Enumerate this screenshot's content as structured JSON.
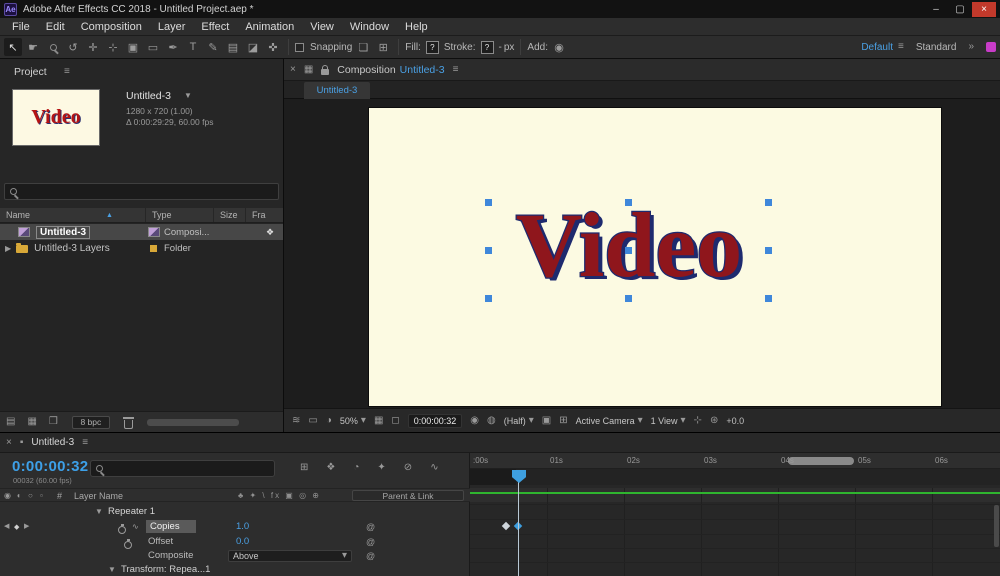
{
  "titlebar": {
    "app_icon": "Ae",
    "title": "Adobe After Effects CC 2018 - Untitled Project.aep *"
  },
  "menubar": {
    "items": [
      "File",
      "Edit",
      "Composition",
      "Layer",
      "Effect",
      "Animation",
      "View",
      "Window",
      "Help"
    ]
  },
  "toolbar": {
    "snapping_label": "Snapping",
    "fill_label": "Fill:",
    "fill_value": "?",
    "stroke_label": "Stroke:",
    "stroke_value": "?",
    "stroke_width": "-",
    "px_label": "px",
    "add_label": "Add:",
    "workspace_active": "Default",
    "workspace_other": "Standard"
  },
  "project": {
    "tab_label": "Project",
    "preview_text": "Video",
    "item_name": "Untitled-3",
    "item_info_line1": "1280 x 720 (1.00)",
    "item_info_line2": "Δ 0:00:29:29, 60.00 fps",
    "columns": {
      "name": "Name",
      "type": "Type",
      "size": "Size",
      "frames": "Fra"
    },
    "rows": [
      {
        "name": "Untitled-3",
        "type": "Composi..."
      },
      {
        "name": "Untitled-3 Layers",
        "type": "Folder"
      }
    ],
    "bpc_label": "8 bpc"
  },
  "comp": {
    "tab_prefix": "Composition",
    "tab_name": "Untitled-3",
    "subtab_label": "Untitled-3",
    "canvas_text": "Video",
    "zoom_value": "50%",
    "timecode": "0:00:00:32",
    "resolution_value": "(Half)",
    "camera_value": "Active Camera",
    "view_value": "1 View",
    "exposure_value": "+0.0"
  },
  "timeline": {
    "tab_label": "Untitled-3",
    "timecode": "0:00:00:32",
    "frames_label": "00032 (60.00 fps)",
    "header": {
      "index": "#",
      "layer_name": "Layer Name",
      "switches": "♣ ✦ \\ fx ▣ ◎ ⊕",
      "parent_link": "Parent & Link"
    },
    "rows": [
      {
        "label": "Repeater 1"
      },
      {
        "label": "Copies",
        "value": "1.0"
      },
      {
        "label": "Offset",
        "value": "0.0"
      },
      {
        "label": "Composite",
        "value": "Above"
      },
      {
        "label": "Transform: Repea...1"
      }
    ],
    "ruler_labels": [
      ":00s",
      "01s",
      "02s",
      "03s",
      "04s",
      "05s",
      "06s"
    ]
  },
  "icons": {
    "minimize": "–",
    "maximize": "▢",
    "close": "×",
    "selection_tool": "↖",
    "hand_tool": "☛",
    "orbit_tool": "↺",
    "pan_tool": "✛",
    "dolly_tool": "⊹",
    "pan_behind_tool": "▣",
    "shape_tool": "▭",
    "pen_tool": "✒",
    "type_tool": "T",
    "brush_tool": "✎",
    "clone_tool": "▤",
    "eraser_tool": "◪",
    "puppet_tool": "✜",
    "snap_shape": "❏",
    "snap_grid": "⊞",
    "add_badge": "◉",
    "menu": "≡",
    "overflow": "»",
    "close_small": "×",
    "panel_box": "▦",
    "tab_chip": "▪",
    "twirl_down": "▼",
    "twirl_right": "▶",
    "sort_asc": "▲",
    "caret": "▾",
    "usage": "❖",
    "footage_a": "▤",
    "footage_b": "▦",
    "footage_c": "❒",
    "eye": "◉",
    "audio": "◖",
    "solo": "○",
    "lock_col": "▫",
    "kf_prev": "◀",
    "kf_dot": "◆",
    "kf_next": "▶",
    "graph": "∿",
    "pickwhip": "@",
    "flowchart": "⊞",
    "shy": "❖",
    "frame_blend": "◔",
    "motion_blur": "✦",
    "brainstorm": "⊘",
    "graph_editor": "∿",
    "vb_flowchart": "≋",
    "vb_monitor": "▭",
    "vb_channels": "◑",
    "vb_grid": "▦",
    "vb_roi": "◻",
    "vb_snapshot": "◉",
    "vb_show_snapshot": "◍",
    "vb_target": "▣",
    "vb_pixel": "⊞",
    "vb_wireframe": "⊹",
    "vb_fast_preview": "⊛"
  }
}
